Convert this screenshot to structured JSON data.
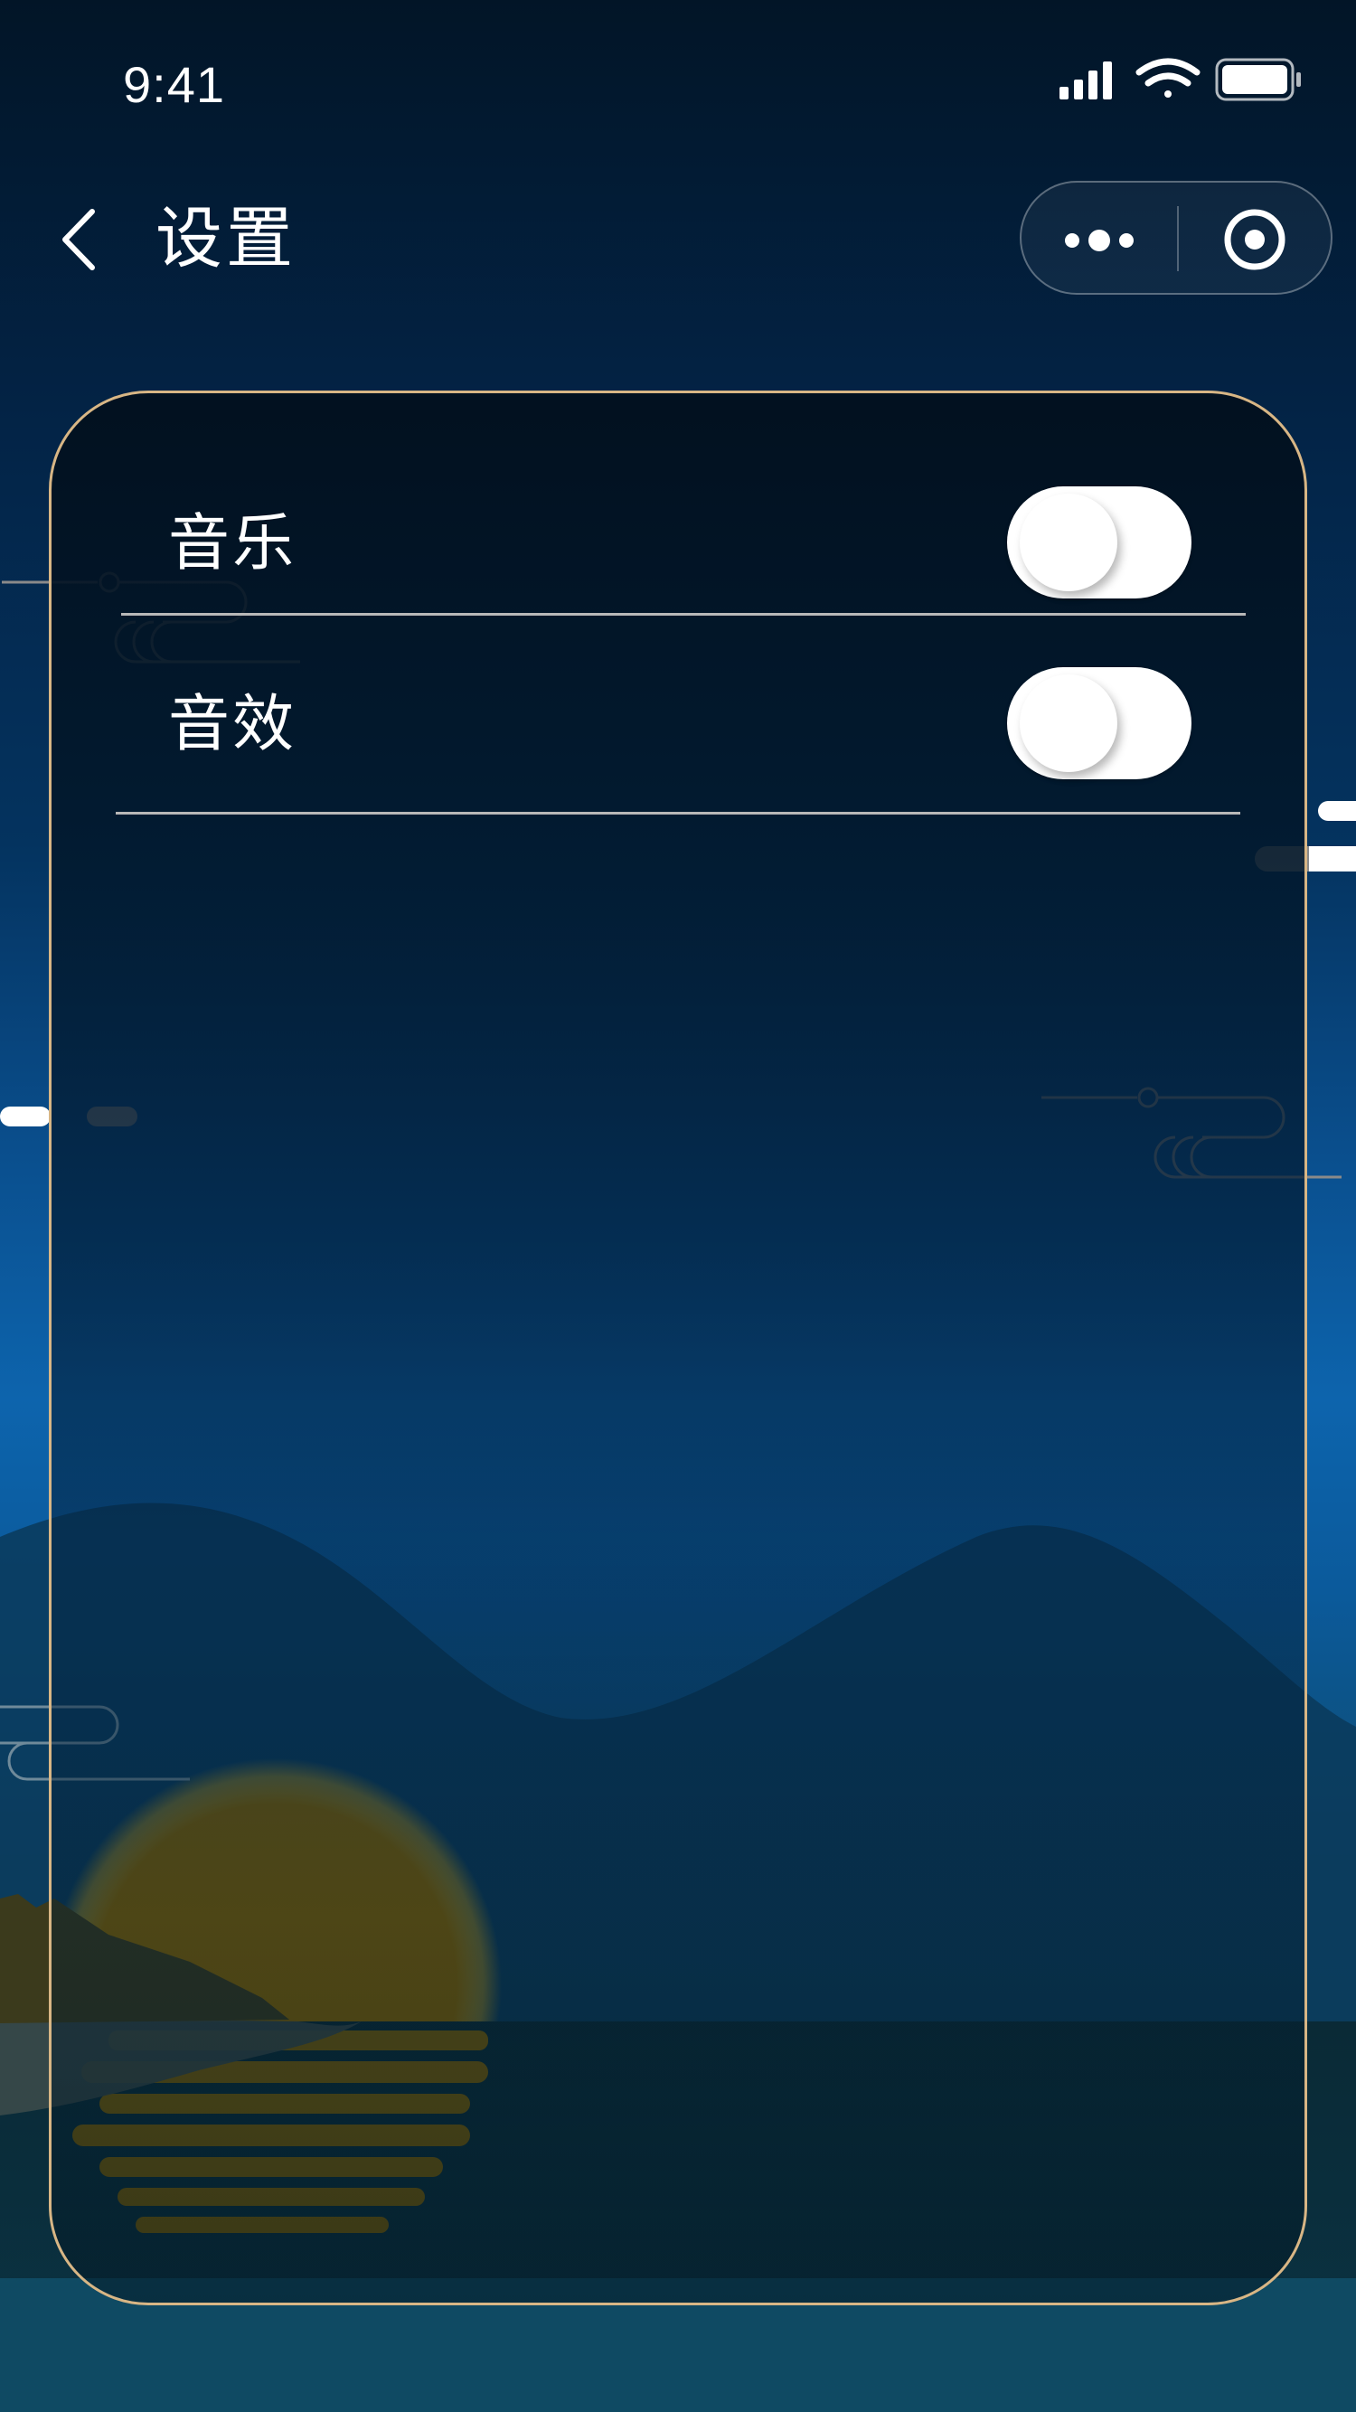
{
  "status_bar": {
    "time": "9:41",
    "icons": [
      "signal-icon",
      "wifi-icon",
      "battery-icon"
    ]
  },
  "nav": {
    "back_icon": "chevron-left-icon",
    "title": "设置",
    "capsule": {
      "more_icon": "more-dots-icon",
      "close_icon": "target-circle-icon"
    }
  },
  "settings": {
    "items": [
      {
        "label": "音乐",
        "enabled": false
      },
      {
        "label": "音效",
        "enabled": false
      }
    ]
  },
  "colors": {
    "panel_border": "#d8b685",
    "divider": "#b8b8b8",
    "sun": "#8a6600",
    "sky_top": "#021527",
    "sky_bottom": "#0d64ad"
  }
}
